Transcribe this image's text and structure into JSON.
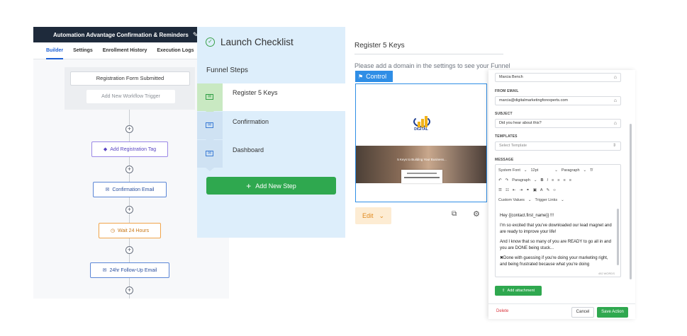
{
  "workflow": {
    "title": "Automation Advantage Confirmation & Reminders",
    "tabs": [
      "Builder",
      "Settings",
      "Enrollment History",
      "Execution Logs"
    ],
    "trigger_label": "Registration Form Submitted",
    "add_trigger_label": "Add New Workflow Trigger",
    "nodes": [
      {
        "label": "Add Registration Tag",
        "icon": "tag-icon",
        "color": "#9b88e6"
      },
      {
        "label": "Confirmation Email",
        "icon": "mail-icon",
        "color": "#5b86d6"
      },
      {
        "label": "Wait 24 Hours",
        "icon": "clock-icon",
        "color": "#f0a44a"
      },
      {
        "label": "24hr Follow-Up Email",
        "icon": "mail-icon",
        "color": "#5b86d6"
      }
    ],
    "plus": "+"
  },
  "checklist": {
    "title": "Launch Checklist",
    "steps_label": "Funnel Steps",
    "steps": [
      "Register 5 Keys",
      "Confirmation",
      "Dashboard"
    ],
    "add_step_label": "Add New Step",
    "colors": {
      "accent": "#2fa84f",
      "panel": "#ddeefb"
    }
  },
  "funnel_step": {
    "title": "Register 5 Keys",
    "domain_notice": "Please add a domain in the settings to see your Funnel",
    "control_label": "Control",
    "logo_text": "DIGITAL",
    "hero_text": "5 Keys to Building Your Business...",
    "edit_label": "Edit",
    "colors": {
      "accent": "#2f8ee6"
    }
  },
  "email": {
    "from_name": "Marcia Bench",
    "from_email_label": "FROM EMAIL",
    "from_email": "marcia@digitalmarketingforexperts.com",
    "subject_label": "SUBJECT",
    "subject": "Did you hear about this?",
    "templates_label": "TEMPLATES",
    "templates_placeholder": "Select Template",
    "message_label": "MESSAGE",
    "toolbar": {
      "font": "System Font",
      "size": "12pt",
      "block": "Paragraph",
      "block2": "Paragraph",
      "custom_values": "Custom Values",
      "trigger_links": "Trigger Links"
    },
    "body": [
      "Hey {{contact.first_name}} !!!",
      "I'm so excited that you've downloaded our lead magnet and are ready to improve your life!",
      "And I know that so many of you are READY to go all in and you are DONE being stuck...",
      "✖Done with guessing if you're doing your marketing right, and being frustrated because what you're doing"
    ],
    "word_count": "492 WORDS",
    "attach_label": "Add attachment",
    "delete_label": "Delete",
    "cancel_label": "Cancel",
    "save_label": "Save Action"
  }
}
